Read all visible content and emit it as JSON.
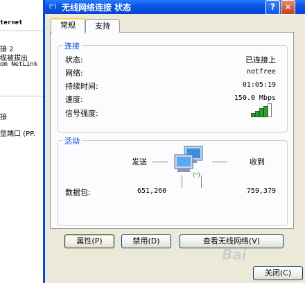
{
  "background_window": {
    "lines": [
      "ternet",
      "接 2",
      "缆被拔出",
      "om NetLink",
      "接",
      "型端口 (PP."
    ]
  },
  "dialog": {
    "title": "无线网络连接 状态",
    "title_icon_glyph": "(ᵒ)",
    "help_glyph": "?",
    "close_glyph": "✕"
  },
  "tabs": [
    {
      "label": "常规",
      "active": true
    },
    {
      "label": "支持",
      "active": false
    }
  ],
  "connection": {
    "group_title": "连接",
    "rows": [
      {
        "label": "状态:",
        "value": "已连接上"
      },
      {
        "label": "网络:",
        "value": "notfree"
      },
      {
        "label": "持续时间:",
        "value": "01:05:19"
      },
      {
        "label": "速度:",
        "value": "150.0 Mbps"
      }
    ],
    "signal_label": "信号强度:",
    "signal_bars_total": 5,
    "signal_bars_on": 4
  },
  "activity": {
    "group_title": "活动",
    "sent_label": "发送",
    "received_label": "收到",
    "packets_label": "数据包:",
    "packets_sent": "651,260",
    "packets_received": "759,379",
    "network_icon": "network-computers-icon"
  },
  "buttons": {
    "properties": "属性(P)",
    "disable": "禁用(D)",
    "view_wireless": "查看无线网络(V)",
    "close": "关闭(C)"
  },
  "watermark": "Bai"
}
